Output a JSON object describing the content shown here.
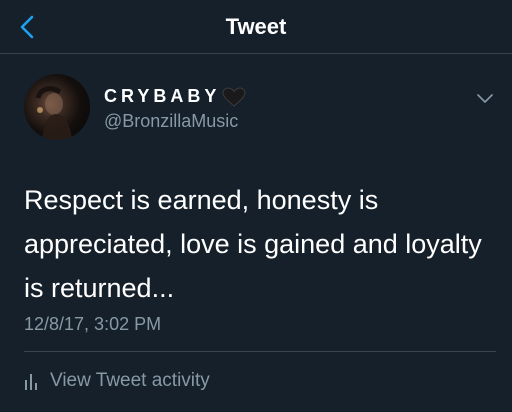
{
  "nav": {
    "title": "Tweet",
    "back_icon": "back-arrow-icon",
    "accent": "#1da1f2"
  },
  "tweet": {
    "display_name": "CRYBABY",
    "name_emoji": "black-heart-icon",
    "handle": "@BronzillaMusic",
    "text": "Respect is earned, honesty is appreciated, love is gained and loyalty is returned...",
    "timestamp": "12/8/17, 3:02 PM",
    "menu_icon": "chevron-down-icon"
  },
  "activity": {
    "icon": "bar-chart-icon",
    "label": "View Tweet activity"
  },
  "colors": {
    "background": "#15202b",
    "text_primary": "#ffffff",
    "text_secondary": "#8899a6",
    "divider": "#38444d"
  }
}
